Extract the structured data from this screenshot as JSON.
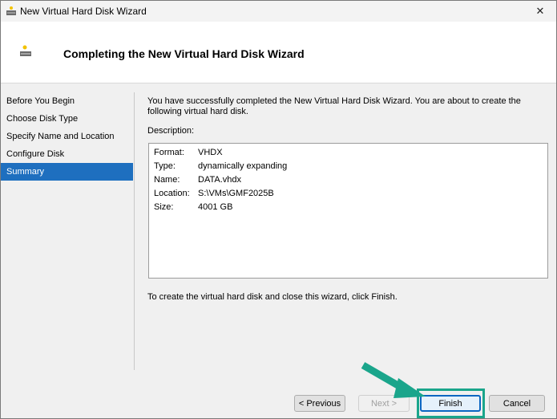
{
  "window": {
    "title": "New Virtual Hard Disk Wizard",
    "close_glyph": "✕"
  },
  "header": {
    "heading": "Completing the New Virtual Hard Disk Wizard"
  },
  "nav": {
    "items": [
      {
        "label": "Before You Begin"
      },
      {
        "label": "Choose Disk Type"
      },
      {
        "label": "Specify Name and Location"
      },
      {
        "label": "Configure Disk"
      },
      {
        "label": "Summary"
      }
    ],
    "active_index": 4
  },
  "main": {
    "intro_line1": "You have successfully completed the New Virtual Hard Disk Wizard. You are about to create the",
    "intro_line2": "following virtual hard disk.",
    "description_label": "Description:",
    "description": [
      {
        "key": "Format:",
        "value": "VHDX"
      },
      {
        "key": "Type:",
        "value": "dynamically expanding"
      },
      {
        "key": "Name:",
        "value": "DATA.vhdx"
      },
      {
        "key": "Location:",
        "value": "S:\\VMs\\GMF2025B"
      },
      {
        "key": "Size:",
        "value": "4001 GB"
      }
    ],
    "footer_text": "To create the virtual hard disk and close this wizard, click Finish."
  },
  "buttons": {
    "previous": "< Previous",
    "next": "Next >",
    "finish": "Finish",
    "cancel": "Cancel"
  },
  "colors": {
    "accent_selected": "#1e6fbf",
    "highlight": "#1aa58b"
  }
}
